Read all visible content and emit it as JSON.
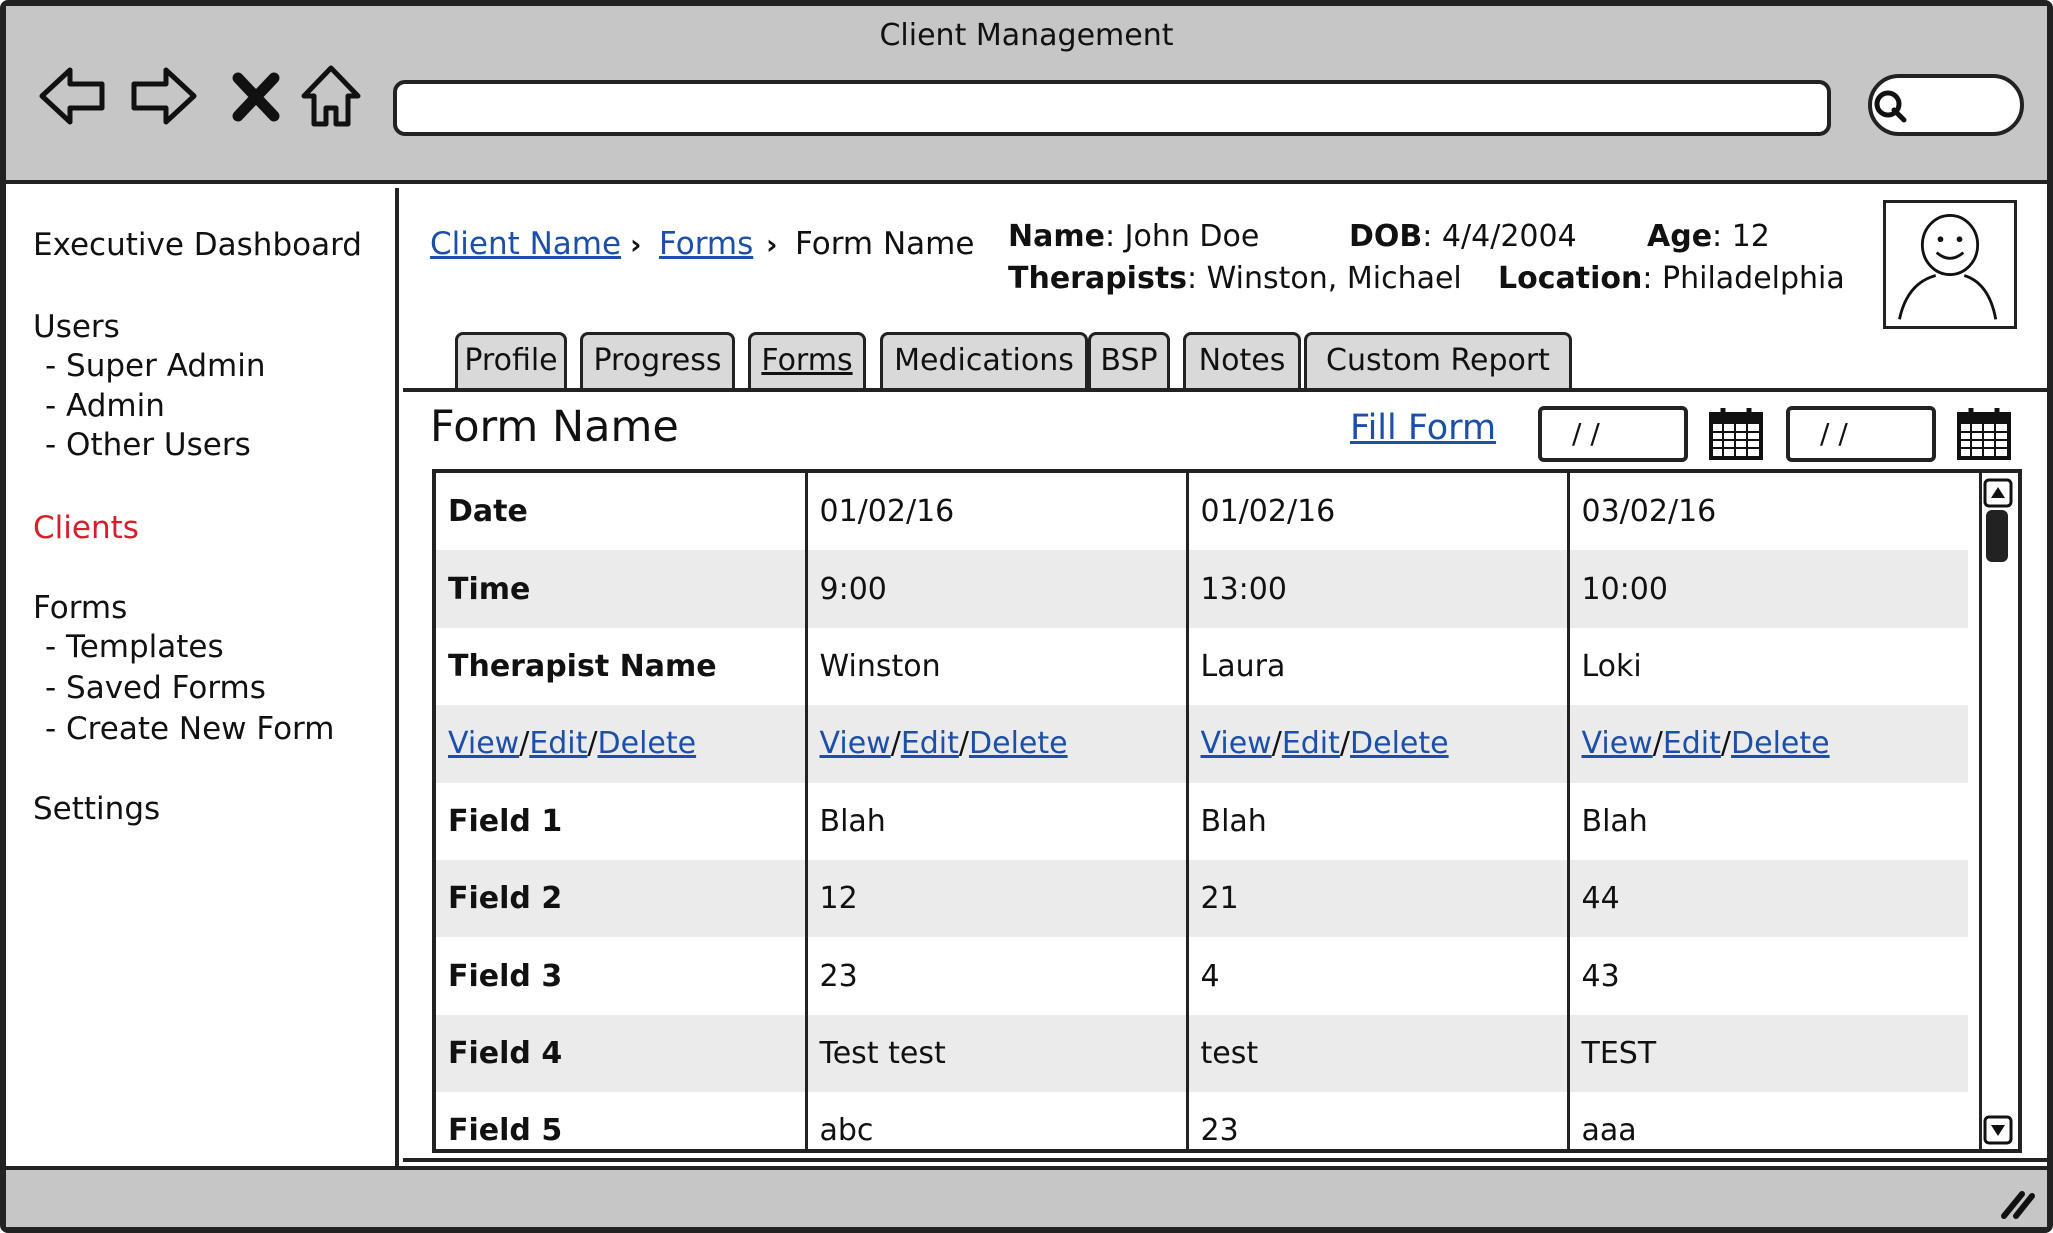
{
  "window": {
    "title": "Client Management"
  },
  "toolbar": {
    "back_icon": "arrow-left-icon",
    "forward_icon": "arrow-right-icon",
    "stop_icon": "close-icon",
    "home_icon": "home-icon",
    "url_value": "",
    "search_icon": "search-icon",
    "search_value": ""
  },
  "sidebar": {
    "items": [
      {
        "label": "Executive Dashboard",
        "level": 0,
        "active": false
      },
      {
        "label": "Users",
        "level": 0,
        "active": false
      },
      {
        "label": "- Super Admin",
        "level": 1,
        "active": false
      },
      {
        "label": "- Admin",
        "level": 1,
        "active": false
      },
      {
        "label": "- Other Users",
        "level": 1,
        "active": false
      },
      {
        "label": "Clients",
        "level": 0,
        "active": true
      },
      {
        "label": "Forms",
        "level": 0,
        "active": false
      },
      {
        "label": "- Templates",
        "level": 1,
        "active": false
      },
      {
        "label": "- Saved Forms",
        "level": 1,
        "active": false
      },
      {
        "label": "- Create New Form",
        "level": 1,
        "active": false
      },
      {
        "label": "Settings",
        "level": 0,
        "active": false
      }
    ],
    "active_color": "#d3202a"
  },
  "breadcrumb": {
    "client": "Client Name",
    "forms": "Forms",
    "current": "Form Name",
    "separator": "›"
  },
  "client_info": {
    "name_label": "Name",
    "name_value": ": John Doe",
    "dob_label": "DOB",
    "dob_value": ": 4/4/2004",
    "age_label": "Age",
    "age_value": ": 12",
    "therapists_label": "Therapists",
    "therapists_value": ": Winston, Michael",
    "location_label": "Location",
    "location_value": ": Philadelphia",
    "avatar_icon": "user-avatar-icon"
  },
  "tabs": [
    {
      "label": "Profile",
      "selected": false
    },
    {
      "label": "Progress",
      "selected": false
    },
    {
      "label": "Forms",
      "selected": true
    },
    {
      "label": "Medications",
      "selected": false
    },
    {
      "label": "BSP",
      "selected": false
    },
    {
      "label": "Notes",
      "selected": false
    },
    {
      "label": "Custom Report",
      "selected": false
    }
  ],
  "panel": {
    "title": "Form Name",
    "fill_form": "Fill Form",
    "date_from": "/ /",
    "date_to": "/ /",
    "calendar_icon": "calendar-icon"
  },
  "table": {
    "rows": [
      [
        "Date",
        "01/02/16",
        "01/02/16",
        "03/02/16"
      ],
      [
        "Time",
        "9:00",
        "13:00",
        "10:00"
      ],
      [
        "Therapist Name",
        "Winston",
        "Laura",
        "Loki"
      ],
      [
        "View/Edit/Delete",
        "View/Edit/Delete",
        "View/Edit/Delete",
        "View/Edit/Delete"
      ],
      [
        "Field 1",
        "Blah",
        "Blah",
        "Blah"
      ],
      [
        "Field 2",
        "12",
        "21",
        "44"
      ],
      [
        "Field 3",
        "23",
        "4",
        "43"
      ],
      [
        "Field 4",
        "Test test",
        "test",
        "TEST"
      ],
      [
        "Field 5",
        "abc",
        "23",
        "aaa"
      ]
    ],
    "actions": {
      "view": "View",
      "edit": "Edit",
      "delete": "Delete",
      "sep": "/"
    }
  },
  "colors": {
    "chrome": "#c6c6c6",
    "link": "#1b4fa8",
    "stripe": "#ebebeb"
  },
  "statusbar": {
    "grip_icon": "resize-grip-icon"
  }
}
